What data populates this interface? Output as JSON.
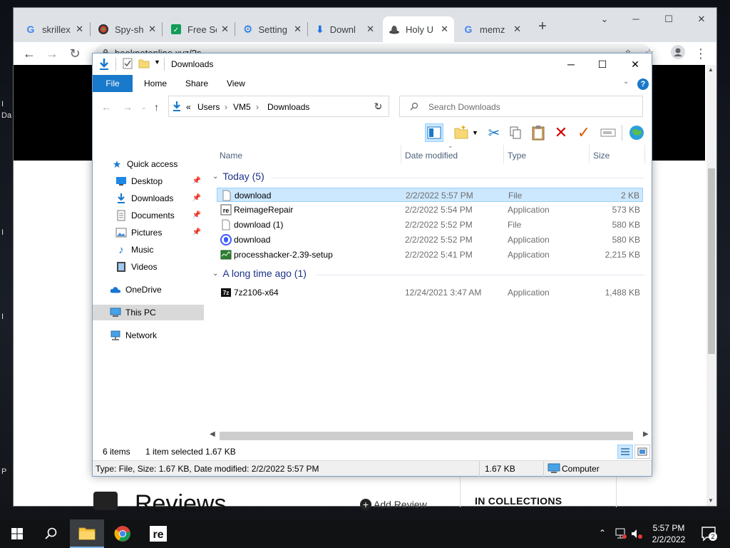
{
  "browser": {
    "tabs": [
      {
        "title": "skrillex",
        "icon": "google-icon"
      },
      {
        "title": "Spy-sh",
        "icon": "spy-icon"
      },
      {
        "title": "Free Sc",
        "icon": "sheets-icon"
      },
      {
        "title": "Setting",
        "icon": "gear-icon"
      },
      {
        "title": "Downl",
        "icon": "download-icon"
      },
      {
        "title": "Holy U",
        "icon": "hat-icon"
      },
      {
        "title": "memz",
        "icon": "google-icon"
      }
    ],
    "active_tab": 5,
    "url": "booknetonline.xyz/?s",
    "page": {
      "reviews_heading": "Reviews",
      "add_review": "Add Review",
      "collections": "IN COLLECTIONS"
    }
  },
  "explorer": {
    "title": "Downloads",
    "ribbon_tabs": {
      "file": "File",
      "home": "Home",
      "share": "Share",
      "view": "View"
    },
    "help": "?",
    "breadcrumb": {
      "prefix": "«",
      "users": "Users",
      "vm5": "VM5",
      "downloads": "Downloads"
    },
    "search_placeholder": "Search Downloads",
    "nav": {
      "quick_access": "Quick access",
      "desktop": "Desktop",
      "downloads": "Downloads",
      "documents": "Documents",
      "pictures": "Pictures",
      "music": "Music",
      "videos": "Videos",
      "onedrive": "OneDrive",
      "this_pc": "This PC",
      "network": "Network"
    },
    "columns": {
      "name": "Name",
      "date": "Date modified",
      "type": "Type",
      "size": "Size"
    },
    "groups": {
      "today": "Today (5)",
      "long_ago": "A long time ago (1)"
    },
    "files_today": [
      {
        "name": "download",
        "date": "2/2/2022 5:57 PM",
        "type": "File",
        "size": "2 KB"
      },
      {
        "name": "ReimageRepair",
        "date": "2/2/2022 5:54 PM",
        "type": "Application",
        "size": "573 KB"
      },
      {
        "name": "download (1)",
        "date": "2/2/2022 5:52 PM",
        "type": "File",
        "size": "580 KB"
      },
      {
        "name": "download",
        "date": "2/2/2022 5:52 PM",
        "type": "Application",
        "size": "580 KB"
      },
      {
        "name": "processhacker-2.39-setup",
        "date": "2/2/2022 5:41 PM",
        "type": "Application",
        "size": "2,215 KB"
      }
    ],
    "files_old": [
      {
        "name": "7z2106-x64",
        "date": "12/24/2021 3:47 AM",
        "type": "Application",
        "size": "1,488 KB"
      }
    ],
    "status": {
      "items": "6 items",
      "selected": "1 item selected",
      "selected_size": "1.67 KB"
    },
    "details_bar": {
      "info": "Type: File, Size: 1.67 KB, Date modified: 2/2/2022 5:57 PM",
      "size": "1.67 KB",
      "location": "Computer"
    }
  },
  "taskbar": {
    "time": "5:57 PM",
    "date": "2/2/2022",
    "notifications": "2"
  },
  "colors": {
    "accent": "#1979ca",
    "selection": "#cce8ff",
    "group_header": "#1e3287"
  }
}
